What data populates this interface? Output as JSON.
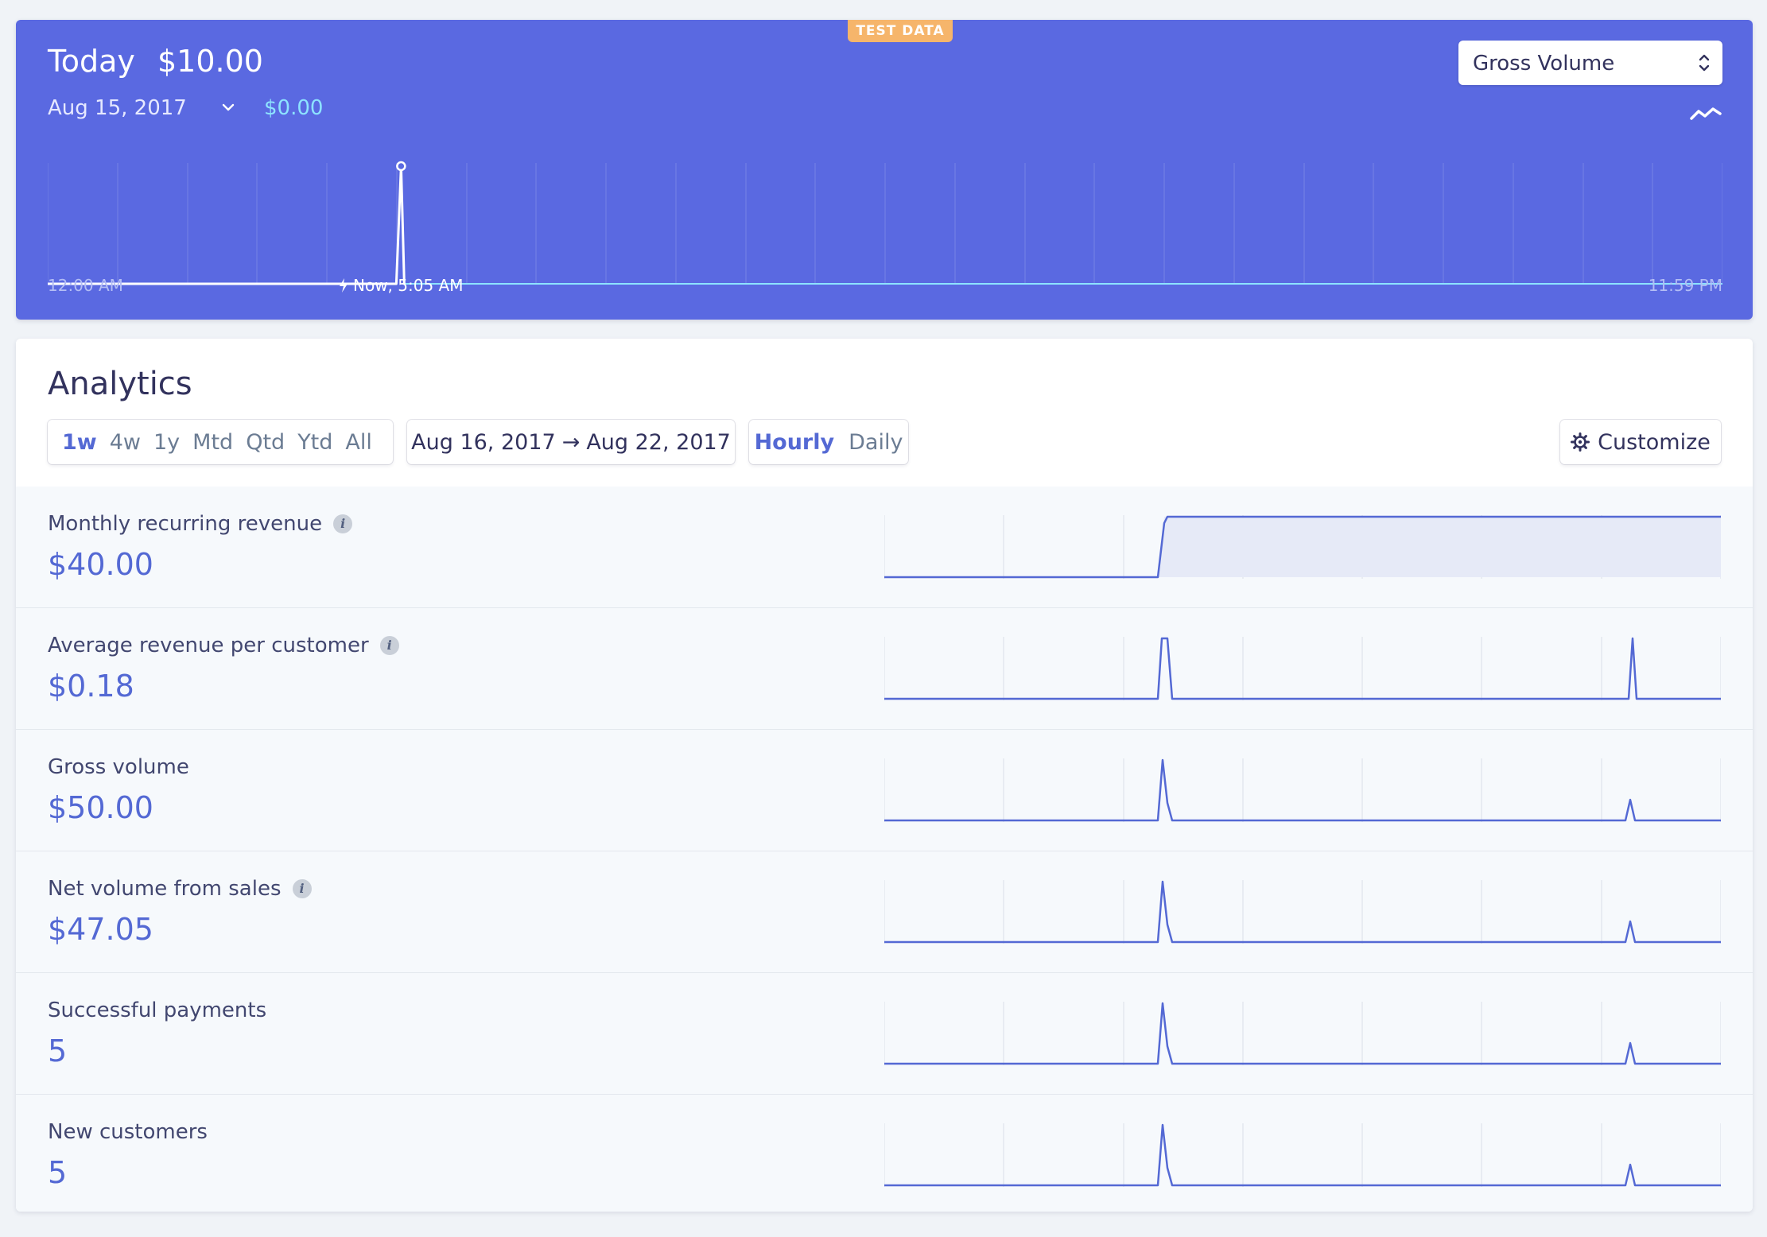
{
  "today": {
    "badge": "TEST DATA",
    "label": "Today",
    "amount": "$10.00",
    "compare_date": "Aug 15, 2017",
    "compare_amount": "$0.00",
    "metric_select": "Gross Volume",
    "axis_start": "12:00 AM",
    "axis_now": "Now, 5:05 AM",
    "axis_end": "11:59 PM",
    "chart": {
      "now_fraction": 0.212,
      "spike_fraction": 0.211
    }
  },
  "analytics": {
    "title": "Analytics",
    "ranges": [
      "1w",
      "4w",
      "1y",
      "Mtd",
      "Qtd",
      "Ytd",
      "All"
    ],
    "active_range": "1w",
    "date_from": "Aug 16, 2017",
    "date_to": "Aug 22, 2017",
    "granularity": [
      "Hourly",
      "Daily"
    ],
    "active_granularity": "Hourly",
    "customize_label": "Customize",
    "metrics": [
      {
        "name": "Monthly recurring revenue",
        "value": "$40.00",
        "info": true,
        "shape": "step"
      },
      {
        "name": "Average revenue per customer",
        "value": "$0.18",
        "info": true,
        "shape": "spikes-equal"
      },
      {
        "name": "Gross volume",
        "value": "$50.00",
        "info": false,
        "shape": "spikes"
      },
      {
        "name": "Net volume from sales",
        "value": "$47.05",
        "info": true,
        "shape": "spikes"
      },
      {
        "name": "Successful payments",
        "value": "5",
        "info": false,
        "shape": "spikes"
      },
      {
        "name": "New customers",
        "value": "5",
        "info": false,
        "shape": "spikes"
      }
    ]
  },
  "colors": {
    "header_bg": "#5a69e1",
    "accent": "#5469d4",
    "badge": "#f6b56b",
    "now_line": "#8de3ff"
  }
}
